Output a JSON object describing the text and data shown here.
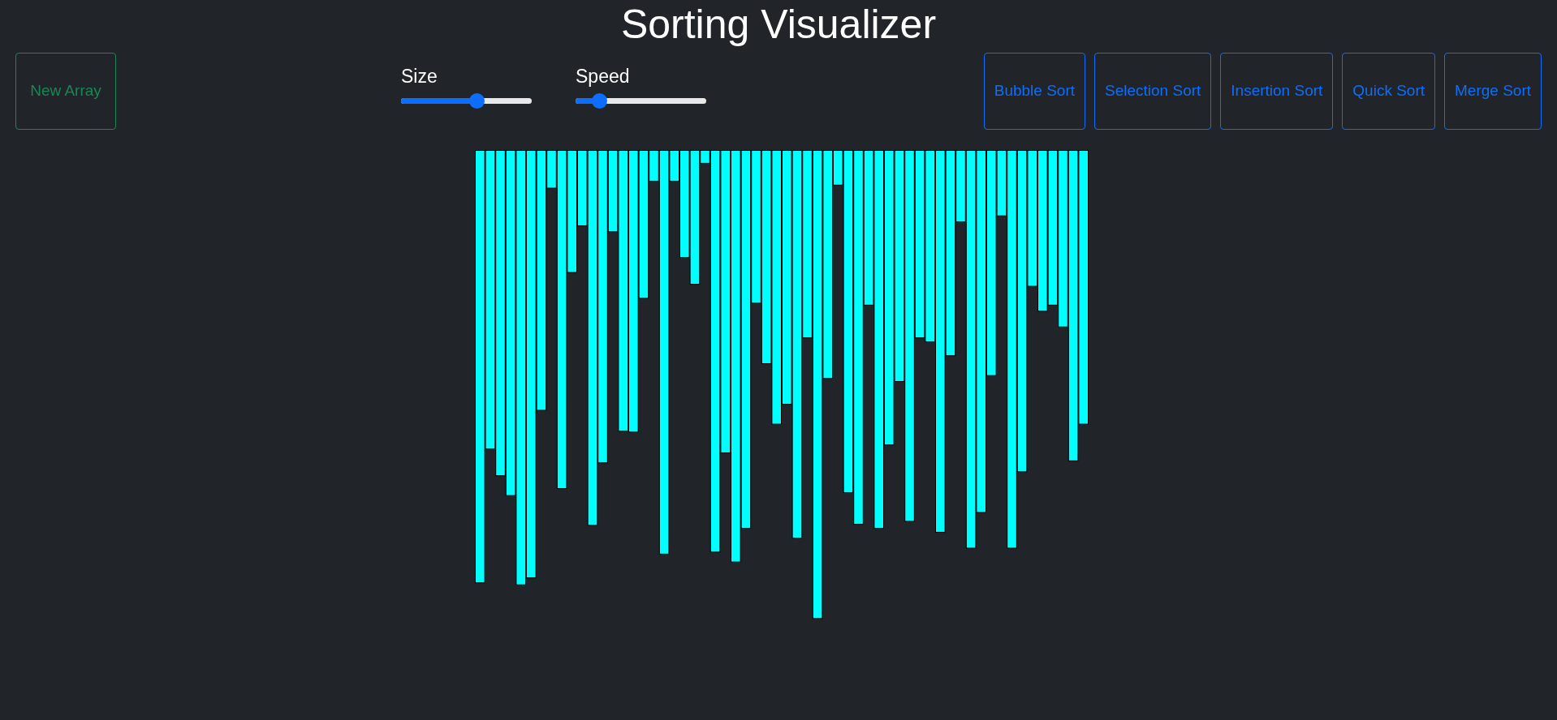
{
  "title": "Sorting Visualizer",
  "new_array_button": "New Array",
  "sliders": [
    {
      "label": "Size",
      "level": 0.58
    },
    {
      "label": "Speed",
      "level": 0.18
    }
  ],
  "sort_buttons": [
    "Bubble Sort",
    "Selection Sort",
    "Insertion Sort",
    "Quick Sort",
    "Merge Sort"
  ]
}
